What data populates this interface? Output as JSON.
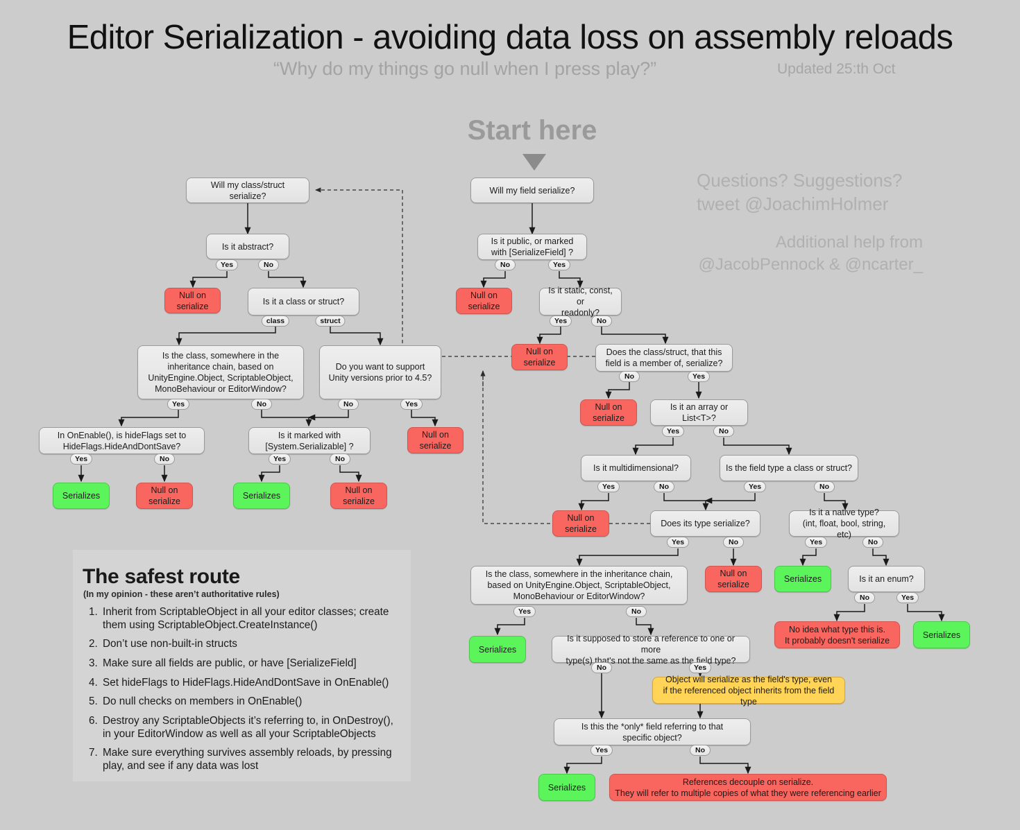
{
  "header": {
    "title": "Editor Serialization - avoiding data loss on assembly reloads",
    "subtitle": "“Why do my things go null when I press play?”",
    "updated": "Updated 25:th Oct",
    "start_here": "Start here",
    "credits_line1": "Questions? Suggestions?",
    "credits_line2": "tweet @JoachimHolmer",
    "credits_line3": "Additional help from",
    "credits_line4": "@JacobPennock & @ncarter_"
  },
  "colors": {
    "background": "#cccccc",
    "question": "#e6e6e6",
    "fail": "#f8665f",
    "success": "#5bf55b",
    "warning": "#ffd457",
    "muted_text": "#a6a6a6"
  },
  "nodes": {
    "n_class_start": "Will my class/struct serialize?",
    "n_abstract": "Is it abstract?",
    "n_abstract_yes_null": "Null on\nserialize",
    "n_class_or_struct": "Is it a class or struct?",
    "n_inherit_left": "Is the class, somewhere in the\ninheritance chain, based on\nUnityEngine.Object, ScriptableObject,\nMonoBehaviour or EditorWindow?",
    "n_unity45": "Do you want to support\nUnity versions prior to 4.5?",
    "n_hideflags": "In OnEnable(), is hideFlags set to\nHideFlags.HideAndDontSave?",
    "n_sysserializable": "Is it marked with\n[System.Serializable] ?",
    "n_unity45_yes_null": "Null on\nserialize",
    "n_hideflags_yes_ser": "Serializes",
    "n_hideflags_no_null": "Null on\nserialize",
    "n_sysser_yes_ser": "Serializes",
    "n_sysser_no_null": "Null on\nserialize",
    "n_field_start": "Will my field serialize?",
    "n_public": "Is it public, or marked\nwith [SerializeField] ?",
    "n_public_no_null": "Null on\nserialize",
    "n_static": "Is it static, const, or\nreadonly?",
    "n_static_yes_null": "Null on\nserialize",
    "n_member_serialize": "Does the class/struct, that this\nfield is a member of, serialize?",
    "n_member_no_null": "Null on\nserialize",
    "n_array": "Is it an array or List<T>?",
    "n_multidim": "Is it multidimensional?",
    "n_fieldtype_class": "Is the field type a class or struct?",
    "n_multidim_yes_null": "Null on\nserialize",
    "n_type_serialize": "Does its type serialize?",
    "n_native": "Is it a native type?\n(int, float, bool, string, etc)",
    "n_type_no_null": "Null on\nserialize",
    "n_native_yes_ser": "Serializes",
    "n_enum": "Is it an enum?",
    "n_noidea": "No idea what type this is.\nIt probably doesn't serialize",
    "n_enum_yes_ser": "Serializes",
    "n_inherit_right": "Is the class, somewhere in the inheritance chain,\nbased on UnityEngine.Object, ScriptableObject,\nMonoBehaviour or EditorWindow?",
    "n_inherit_right_yes_ser": "Serializes",
    "n_store_ref": "Is it supposed to store a reference to one or more\ntype(s) that's not the same as the field type?",
    "n_note_yellow": "Object will serialize as the field's type, even\nif the referenced object inherits from the field type",
    "n_only_field": "Is this the *only* field referring to that\nspecific object?",
    "n_only_yes_ser": "Serializes",
    "n_decouple": "References decouple on serialize.\nThey will refer to multiple copies of what they were referencing earlier"
  },
  "edge_labels": {
    "abstract_yes": "Yes",
    "abstract_no": "No",
    "cos_class": "class",
    "cos_struct": "struct",
    "inherit_left_yes": "Yes",
    "inherit_left_no": "No",
    "unity45_no": "No",
    "unity45_yes": "Yes",
    "hideflags_yes": "Yes",
    "hideflags_no": "No",
    "sysser_yes": "Yes",
    "sysser_no": "No",
    "public_no": "No",
    "public_yes": "Yes",
    "static_yes": "Yes",
    "static_no": "No",
    "member_no": "No",
    "member_yes": "Yes",
    "array_yes": "Yes",
    "array_no": "No",
    "multidim_yes": "Yes",
    "multidim_no": "No",
    "fieldtype_yes": "Yes",
    "fieldtype_no": "No",
    "typeser_yes": "Yes",
    "typeser_no": "No",
    "native_yes": "Yes",
    "native_no": "No",
    "enum_no": "No",
    "enum_yes": "Yes",
    "inherit_right_yes": "Yes",
    "inherit_right_no": "No",
    "storeref_no": "No",
    "storeref_yes": "Yes",
    "only_yes": "Yes",
    "only_no": "No"
  },
  "panel": {
    "heading": "The safest route",
    "subheading": "(In my opinion - these aren’t authoritative rules)",
    "items": [
      "Inherit from ScriptableObject in all your editor classes; create them using ScriptableObject.CreateInstance()",
      "Don’t use non-built-in structs",
      "Make sure all fields are public, or have [SerializeField]",
      "Set hideFlags to HideFlags.HideAndDontSave in OnEnable()",
      "Do null checks on members in OnEnable()",
      "Destroy any ScriptableObjects it’s referring to, in OnDestroy(), in your EditorWindow as well as all your ScriptableObjects",
      "Make sure everything survives assembly reloads, by pressing play, and see if any data was lost"
    ]
  }
}
